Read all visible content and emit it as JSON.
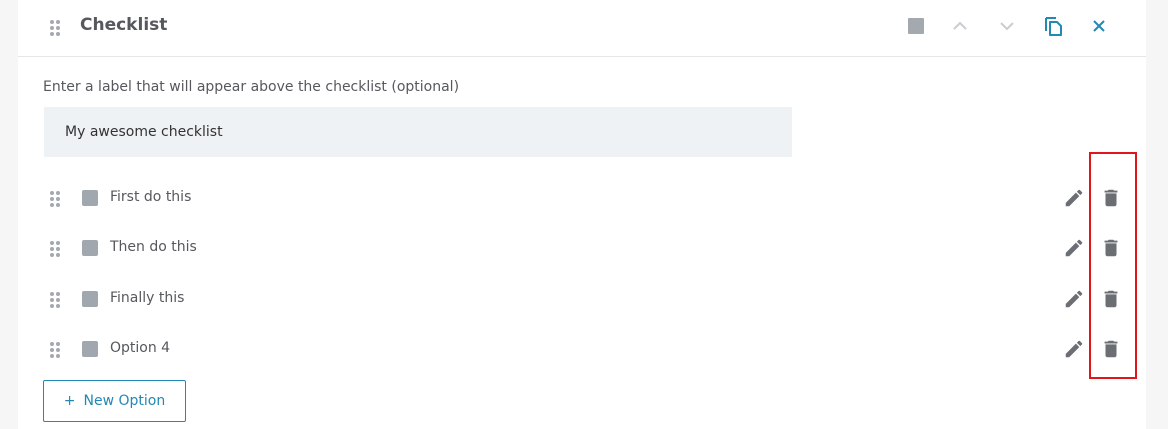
{
  "header": {
    "title": "Checklist",
    "icons": [
      "stop-icon",
      "chevron-up-icon",
      "chevron-down-icon",
      "copy-icon",
      "close-icon"
    ]
  },
  "label_field": {
    "prompt": "Enter a label that will appear above the checklist (optional)",
    "value": "My awesome checklist"
  },
  "options": [
    {
      "label": "First do this"
    },
    {
      "label": "Then do this"
    },
    {
      "label": "Finally this"
    },
    {
      "label": "Option 4"
    }
  ],
  "new_option": {
    "plus": "+",
    "label": "New Option"
  },
  "colors": {
    "accent": "#2388b3",
    "highlight": "#e0161a",
    "icon_gray": "#6b6e73",
    "checkbox_gray": "#a1a7af",
    "input_bg": "#eff2f5"
  }
}
